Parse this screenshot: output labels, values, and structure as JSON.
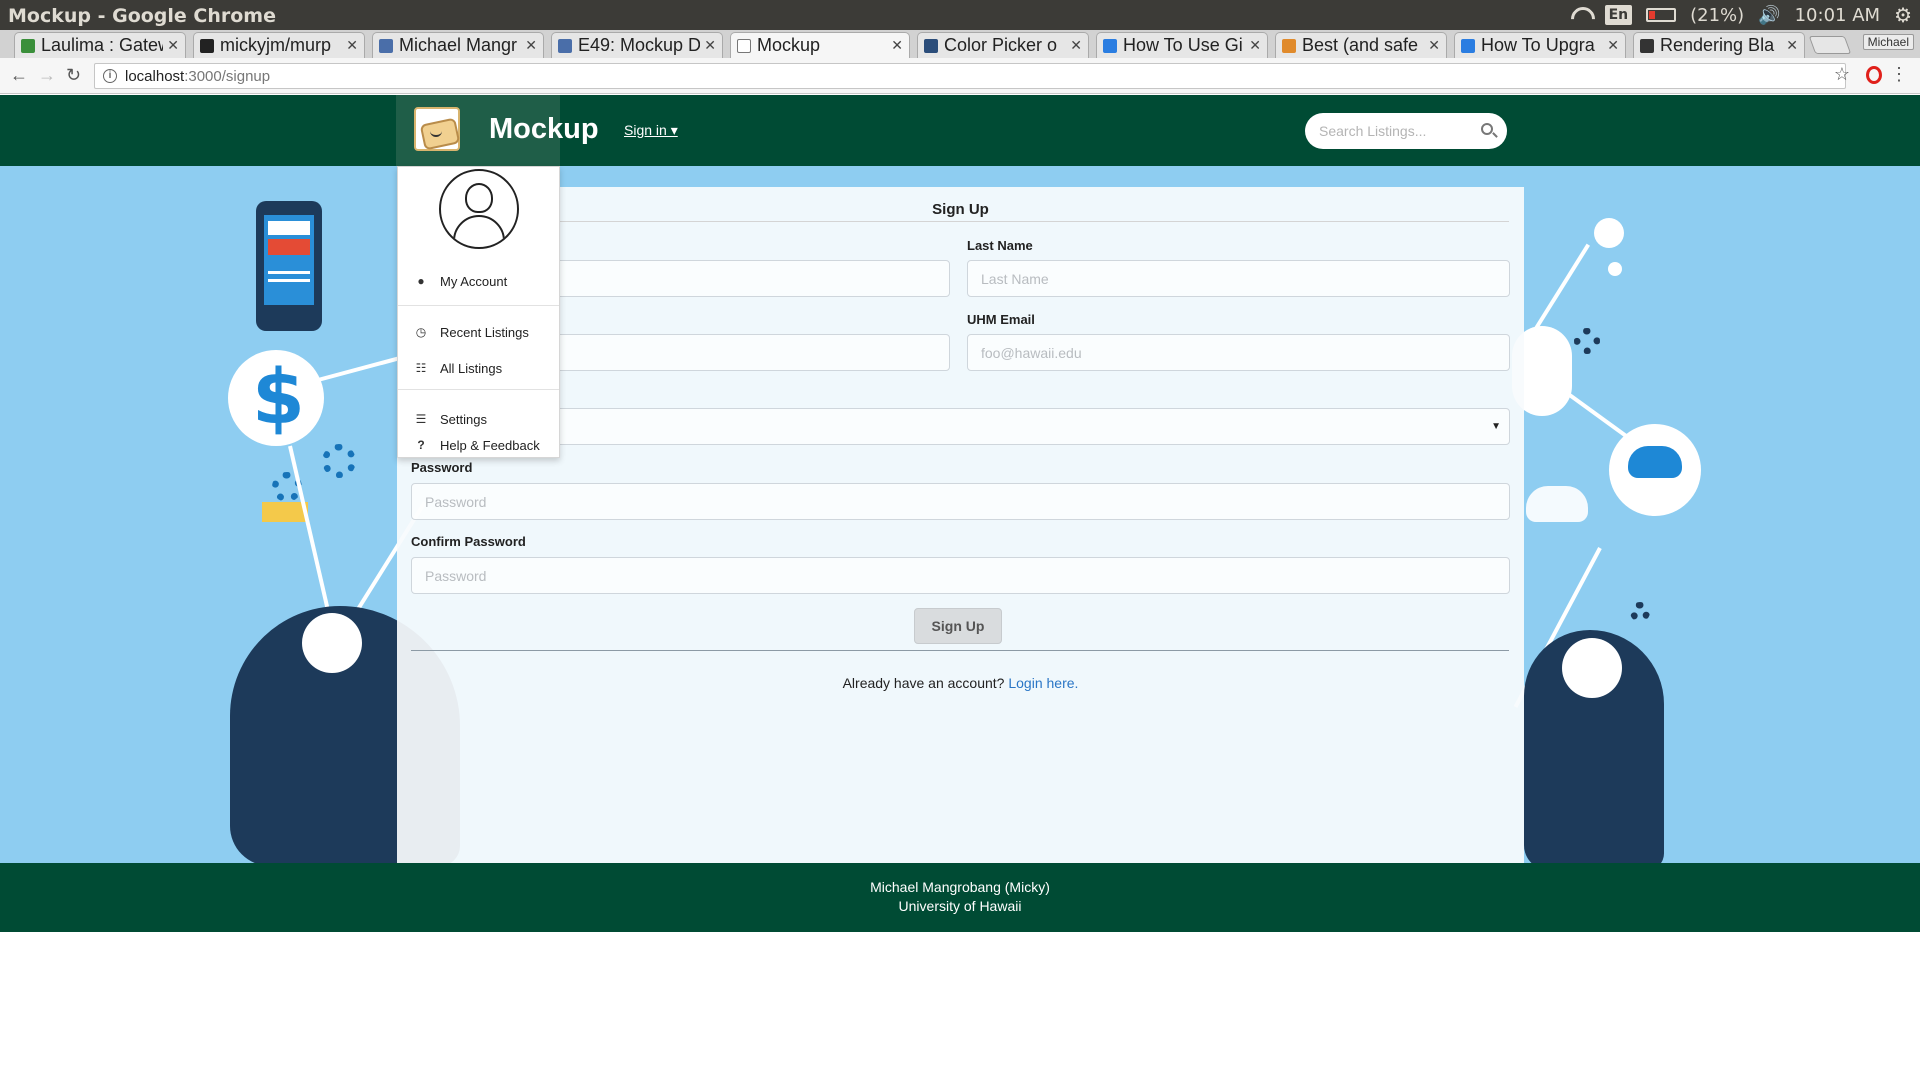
{
  "window": {
    "title": "Mockup - Google Chrome",
    "language": "En",
    "battery": "(21%)",
    "clock": "10:01 AM"
  },
  "tabs": [
    {
      "label": "Laulima : Gatew",
      "color": "#3a8f3a"
    },
    {
      "label": "mickyjm/murp",
      "color": "#222222"
    },
    {
      "label": "Michael Mangr",
      "color": "#4a6ea9"
    },
    {
      "label": "E49: Mockup D",
      "color": "#4a6ea9"
    },
    {
      "label": "Mockup",
      "color": "#ffffff"
    },
    {
      "label": "Color Picker o",
      "color": "#2b4d7a"
    },
    {
      "label": "How To Use Gi",
      "color": "#2a7de1"
    },
    {
      "label": "Best (and safe",
      "color": "#e08a2b"
    },
    {
      "label": "How To Upgra",
      "color": "#2a7de1"
    },
    {
      "label": "Rendering Bla",
      "color": "#333333"
    }
  ],
  "profile": "Michael",
  "address": {
    "host": "localhost",
    "path": ":3000/signup"
  },
  "nav": {
    "brand": "Mockup",
    "signin": "Sign in ▾",
    "search_placeholder": "Search Listings..."
  },
  "dropdown": {
    "items": [
      {
        "label": "My Account",
        "icon": "user-icon"
      },
      {
        "label": "Recent Listings",
        "icon": "clock-icon"
      },
      {
        "label": "All Listings",
        "icon": "list-icon"
      },
      {
        "label": "Settings",
        "icon": "sliders-icon"
      },
      {
        "label": "Help & Feedback",
        "icon": "question-icon"
      }
    ]
  },
  "form": {
    "title": "Sign Up",
    "first_name_placeholder": "",
    "last_name_label": "Last Name",
    "last_name_placeholder": "Last Name",
    "username_placeholder": "",
    "email_label": "UHM Email",
    "email_placeholder": "foo@hawaii.edu",
    "password_label": "Password",
    "password_placeholder": "Password",
    "confirm_label": "Confirm Password",
    "confirm_placeholder": "Password",
    "submit": "Sign Up",
    "already_text": "Already have an account?",
    "login_link": "Login here."
  },
  "footer": {
    "line1": "Michael Mangrobang (Micky)",
    "line2": "University of Hawaii"
  }
}
